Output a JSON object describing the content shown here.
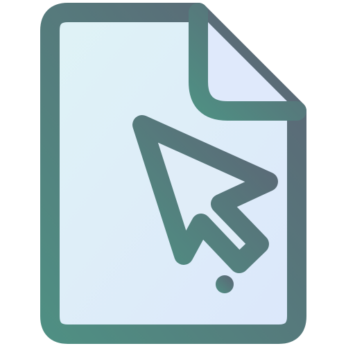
{
  "icon": {
    "name": "document-cursor-icon",
    "colors": {
      "stroke_start": "#4f8f83",
      "stroke_end": "#5c6575",
      "fill_top": "#dff3f6",
      "fill_bottom": "#dce7fb"
    }
  }
}
